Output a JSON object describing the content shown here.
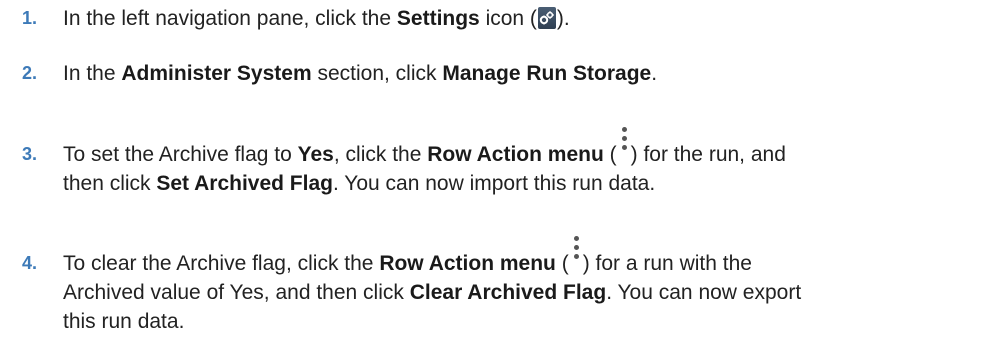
{
  "steps": [
    {
      "number": "1.",
      "t1": "In the left navigation pane, click the ",
      "b1": "Settings",
      "t2": " icon (",
      "icon": "settings-gear-icon",
      "t3": ")."
    },
    {
      "number": "2.",
      "t1": "In the ",
      "b1": "Administer System",
      "t2": " section, click ",
      "b2": "Manage Run Storage",
      "t3": "."
    },
    {
      "number": "3.",
      "t1": "To set the Archive flag to ",
      "b1": "Yes",
      "t2": ", click the ",
      "b2": "Row Action menu",
      "t3": " (",
      "icon": "kebab-menu-icon",
      "t4": ") for the run, and",
      "t5": "then click ",
      "b3": "Set Archived Flag",
      "t6": ". You can now import this run data."
    },
    {
      "number": "4.",
      "t1": "To clear the Archive flag, click the ",
      "b1": "Row Action menu",
      "t2": " (",
      "icon": "kebab-menu-icon",
      "t3": ") for a run with the",
      "t4": "Archived value of Yes, and then click ",
      "b2": "Clear Archived Flag",
      "t5": ". You can now export",
      "t6": "this run data."
    }
  ],
  "colors": {
    "step_number": "#3d7ab8",
    "text": "#222222",
    "settings_icon_bg": "#2f3f52",
    "kebab_dots": "#555555"
  }
}
